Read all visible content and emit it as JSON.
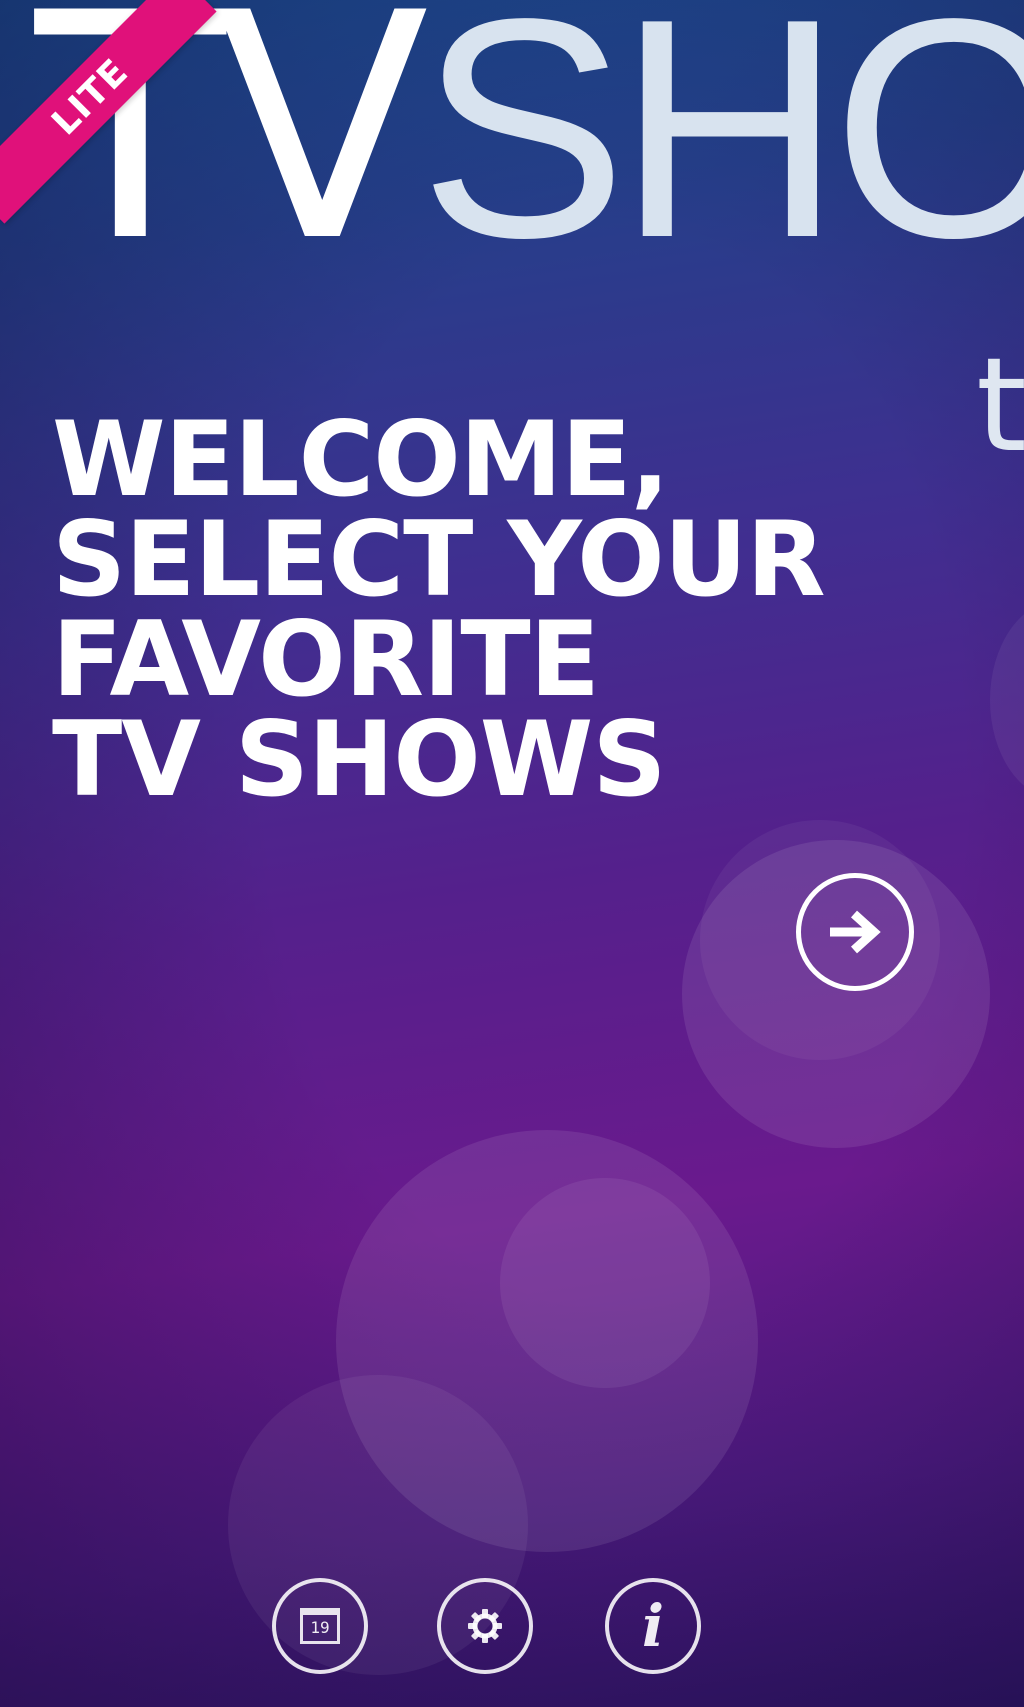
{
  "app": {
    "title_part1": "TV",
    "title_part2": "SHO",
    "badge": "LITE",
    "next_panel_peek": "t"
  },
  "welcome": {
    "lines": [
      "WELCOME,",
      "SELECT YOUR",
      "FAVORITE",
      "TV SHOWS"
    ]
  },
  "next_button": {
    "icon": "arrow-right-icon"
  },
  "app_bar": {
    "calendar_day": "19",
    "buttons": [
      {
        "icon": "calendar-icon"
      },
      {
        "icon": "gear-icon"
      },
      {
        "icon": "info-icon",
        "glyph": "i"
      }
    ]
  },
  "colors": {
    "badge": "#e0117a",
    "background_top": "#1c4a8f",
    "background_mid": "#55208c",
    "background_bottom": "#301566",
    "title_light": "#d8e3ef"
  }
}
